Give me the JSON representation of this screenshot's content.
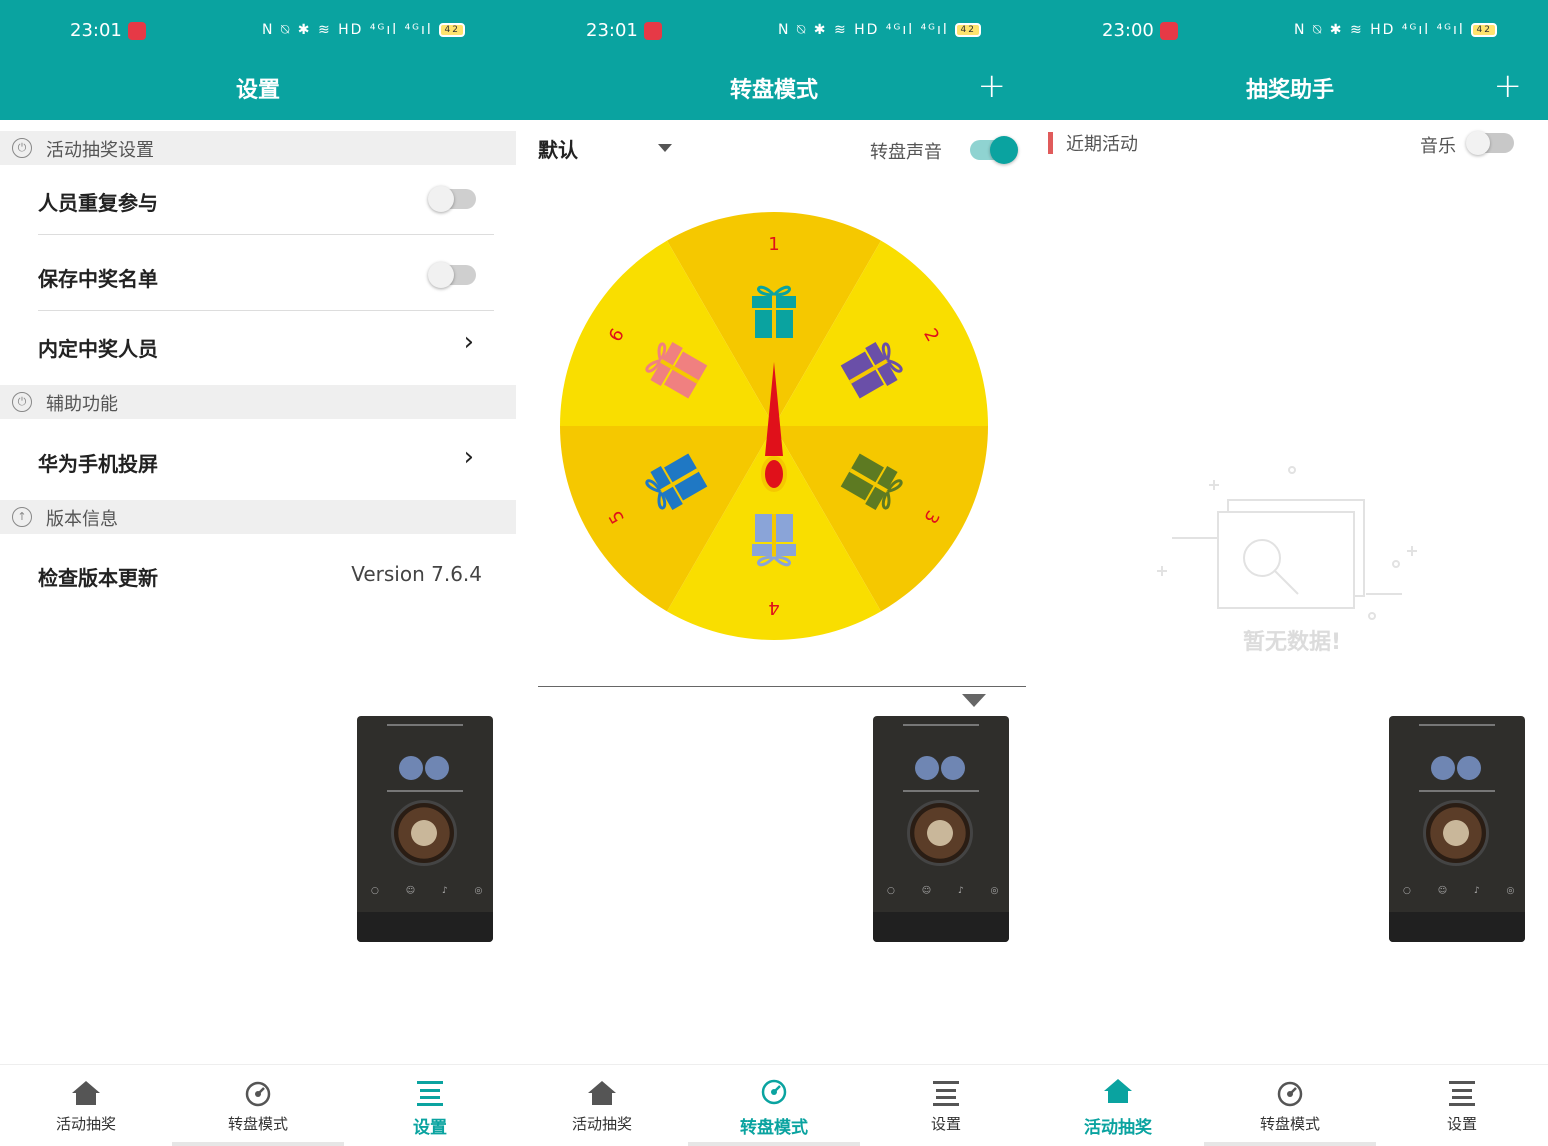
{
  "status": {
    "panel1_time": "23:01",
    "panel2_time": "23:01",
    "panel3_time": "23:00",
    "icons": "N ⍉ ✱ ≋ HD ⁴ᴳıl ⁴ᴳıl",
    "battery": "42"
  },
  "settings_panel": {
    "title": "设置",
    "section_lottery": "活动抽奖设置",
    "repeat_participation": "人员重复参与",
    "save_winners": "保存中奖名单",
    "designated_winners": "内定中奖人员",
    "section_aux": "辅助功能",
    "huawei_cast": "华为手机投屏",
    "section_version": "版本信息",
    "check_update": "检查版本更新",
    "version": "Version 7.6.4"
  },
  "wheel_panel": {
    "title": "转盘模式",
    "plus": "+",
    "preset": "默认",
    "sound_label": "转盘声音",
    "segment_numbers": [
      "1",
      "2",
      "3",
      "4",
      "5",
      "6"
    ],
    "colors": {
      "accent": "#0aa3a0",
      "wheel_light": "#f9de00",
      "wheel_dark": "#f5c800",
      "pointer": "#e0101a"
    }
  },
  "assistant_panel": {
    "title": "抽奖助手",
    "plus": "+",
    "recent": "近期活动",
    "music": "音乐",
    "empty": "暂无数据!"
  },
  "nav": {
    "home": "活动抽奖",
    "wheel": "转盘模式",
    "settings": "设置"
  },
  "colors": {
    "primary": "#0aa3a0",
    "section_bg": "#efefef"
  }
}
